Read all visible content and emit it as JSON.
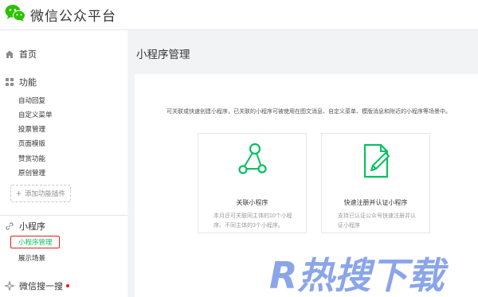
{
  "topbar": {
    "brand": "微信公众平台"
  },
  "sidebar": {
    "home": "首页",
    "function_group": {
      "title": "功能",
      "items": [
        "自动回复",
        "自定义菜单",
        "投票管理",
        "页面模版",
        "赞赏功能",
        "原创管理"
      ],
      "add_label": "添加功能插件"
    },
    "miniprogram_group": {
      "title": "小程序",
      "items": [
        "小程序管理",
        "展示场景"
      ],
      "active_item": "小程序管理"
    },
    "search_group": {
      "title": "微信搜一搜"
    }
  },
  "main": {
    "title": "小程序管理",
    "description": "可关联或快速创建小程序，已关联的小程序可被使用在图文消息、自定义菜单、模版消息和附近的小程序等场景中。",
    "cards": [
      {
        "title": "关联小程序",
        "desc": "本月还可关联同主体的10个小程序、不同主体的3个小程序。",
        "icon": "share-nodes-icon"
      },
      {
        "title": "快速注册并认证小程序",
        "desc": "支持已认证公众号快速注册并认证小程序",
        "icon": "document-pen-icon"
      }
    ]
  },
  "watermark": {
    "text": "R热搜下载"
  },
  "colors": {
    "accent": "#07c160",
    "highlight": "#e02020",
    "watermark": "#2a5bd7"
  }
}
